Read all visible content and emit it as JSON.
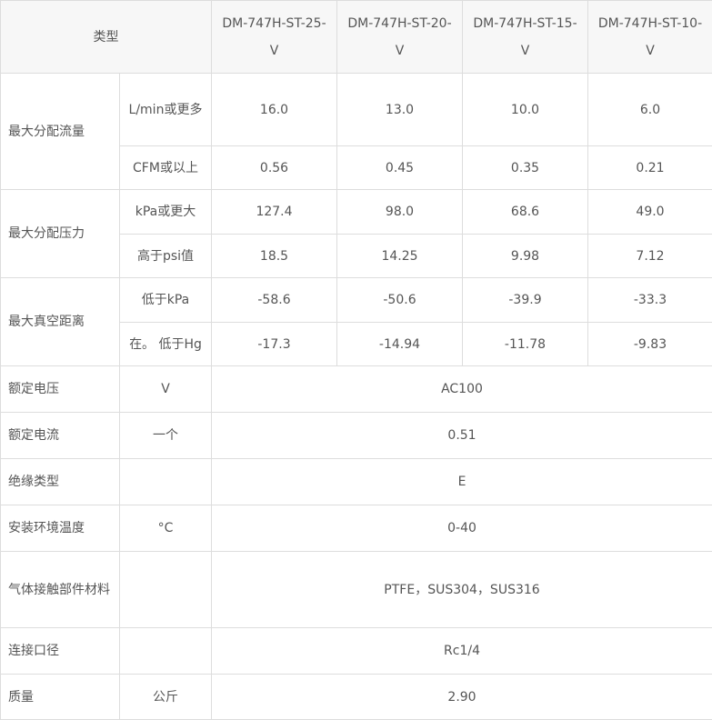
{
  "header": {
    "type_label": "类型",
    "models": [
      "DM-747H-ST-25-V",
      "DM-747H-ST-20-V",
      "DM-747H-ST-15-V",
      "DM-747H-ST-10-V"
    ]
  },
  "flow": {
    "label": "最大分配流量",
    "rows": [
      {
        "unit": "L/min或更多",
        "values": [
          "16.0",
          "13.0",
          "10.0",
          "6.0"
        ]
      },
      {
        "unit": "CFM或以上",
        "values": [
          "0.56",
          "0.45",
          "0.35",
          "0.21"
        ]
      }
    ]
  },
  "pressure": {
    "label": "最大分配压力",
    "rows": [
      {
        "unit": "kPa或更大",
        "values": [
          "127.4",
          "98.0",
          "68.6",
          "49.0"
        ]
      },
      {
        "unit": "高于psi值",
        "values": [
          "18.5",
          "14.25",
          "9.98",
          "7.12"
        ]
      }
    ]
  },
  "vacuum": {
    "label": "最大真空距离",
    "rows": [
      {
        "unit": "低于kPa",
        "values": [
          "-58.6",
          "-50.6",
          "-39.9",
          "-33.3"
        ]
      },
      {
        "unit": "在。 低于Hg",
        "values": [
          "-17.3",
          "-14.94",
          "-11.78",
          "-9.83"
        ]
      }
    ]
  },
  "single_rows": [
    {
      "label": "额定电压",
      "unit": "V",
      "value": "AC100"
    },
    {
      "label": "额定电流",
      "unit": "一个",
      "value": "0.51"
    },
    {
      "label": "绝缘类型",
      "unit": "",
      "value": "E"
    },
    {
      "label": "安装环境温度",
      "unit": "°C",
      "value": "0-40"
    },
    {
      "label": "气体接触部件材料",
      "unit": "",
      "value": "PTFE，SUS304，SUS316"
    },
    {
      "label": "连接口径",
      "unit": "",
      "value": "Rc1/4"
    },
    {
      "label": "质量",
      "unit": "公斤",
      "value": "2.90"
    }
  ]
}
